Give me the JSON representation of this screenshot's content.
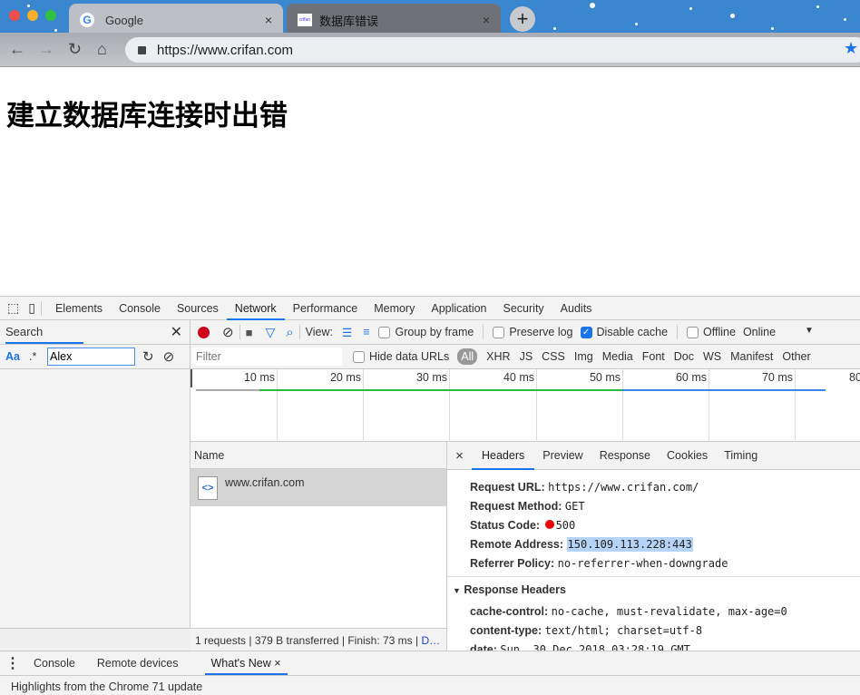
{
  "browser": {
    "tabs": [
      {
        "title": "Google",
        "icon": "google-g-icon",
        "active": false
      },
      {
        "title": "数据库错误",
        "icon": "crifan-favicon-icon",
        "active": true
      }
    ],
    "new_tab": "+",
    "url": "https://www.crifan.com",
    "tab_close": "×",
    "colors": {
      "theme": "#3b87cf",
      "accent": "#1a73e8"
    }
  },
  "page": {
    "heading": "建立数据库连接时出错"
  },
  "devtools": {
    "panels": [
      "Elements",
      "Console",
      "Sources",
      "Network",
      "Performance",
      "Memory",
      "Application",
      "Security",
      "Audits"
    ],
    "active_panel": "Network",
    "search": {
      "title": "Search",
      "case_label": "Aa",
      "regex_label": ".*",
      "query": "Alex"
    },
    "network": {
      "view_label": "View:",
      "group_by_frame": "Group by frame",
      "preserve_log": "Preserve log",
      "disable_cache": "Disable cache",
      "disable_cache_checked": true,
      "offline": "Offline",
      "throttle": "Online",
      "filter_placeholder": "Filter",
      "hide_data_urls": "Hide data URLs",
      "types": [
        "All",
        "XHR",
        "JS",
        "CSS",
        "Img",
        "Media",
        "Font",
        "Doc",
        "WS",
        "Manifest",
        "Other"
      ],
      "ticks": [
        "10 ms",
        "20 ms",
        "30 ms",
        "40 ms",
        "50 ms",
        "60 ms",
        "70 ms",
        "80"
      ],
      "name_header": "Name",
      "requests": [
        {
          "name": "www.crifan.com"
        }
      ],
      "status_bar": "1 requests | 379 B transferred | Finish: 73 ms | ",
      "status_link": "D…"
    },
    "details": {
      "close": "×",
      "tabs": [
        "Headers",
        "Preview",
        "Response",
        "Cookies",
        "Timing"
      ],
      "active_tab": "Headers",
      "general": [
        {
          "key": "Request URL:",
          "value": "https://www.crifan.com/"
        },
        {
          "key": "Request Method:",
          "value": "GET"
        },
        {
          "key": "Status Code:",
          "value": "500"
        },
        {
          "key": "Remote Address:",
          "value": "150.109.113.228:443"
        },
        {
          "key": "Referrer Policy:",
          "value": "no-referrer-when-downgrade"
        }
      ],
      "response_headers_title": "Response Headers",
      "response_headers": [
        {
          "key": "cache-control:",
          "value": "no-cache, must-revalidate, max-age=0"
        },
        {
          "key": "content-type:",
          "value": "text/html; charset=utf-8"
        },
        {
          "key": "date:",
          "value": "Sun, 30 Dec 2018 03:28:19 GMT"
        }
      ]
    },
    "drawer": {
      "tabs": [
        "Console",
        "Remote devices",
        "What's New"
      ],
      "active_tab": "What's New",
      "message": "Highlights from the Chrome 71 update"
    }
  }
}
